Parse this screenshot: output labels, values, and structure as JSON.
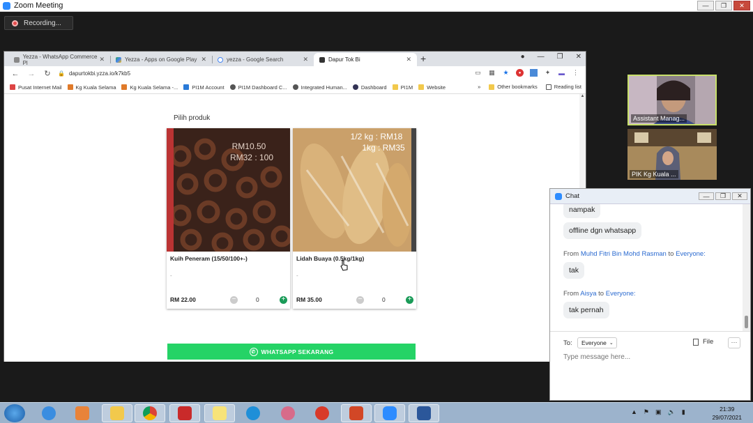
{
  "zoom": {
    "title": "Zoom Meeting",
    "recording": "Recording..."
  },
  "browser": {
    "tabs": [
      {
        "label": "Yezza - WhatsApp Commerce Pl"
      },
      {
        "label": "Yezza - Apps on Google Play"
      },
      {
        "label": "yezza - Google Search"
      },
      {
        "label": "Dapur Tok Bi"
      }
    ],
    "url": "dapurtokbi.yzza.io/k7kb5",
    "bookmarks": [
      "Pusat Internet Mail",
      "Kg Kuala Selama",
      "Kg Kuala Selama -...",
      "PI1M Account",
      "PI1M Dashboard C...",
      "Integrated Human...",
      "Dashboard",
      "PI1M",
      "Website"
    ],
    "bookmarks_more": "»",
    "other_bookmarks": "Other bookmarks",
    "reading_list": "Reading list"
  },
  "shop": {
    "section_title": "Pilih produk",
    "products": [
      {
        "name": "Kuih Peneram (15/50/100+-)",
        "desc": "-",
        "price": "RM 22.00",
        "qty": "0",
        "img_text1": "RM10.50",
        "img_text2": "RM32 : 100"
      },
      {
        "name": "Lidah Buaya (0.5kg/1kg)",
        "desc": "-",
        "price": "RM 35.00",
        "qty": "0",
        "img_text1": "1/2 kg : RM18",
        "img_text2": "1kg : RM35"
      }
    ],
    "whatsapp_button": "WHATSAPP SEKARANG"
  },
  "participants": [
    {
      "name": "Assistant Manag..."
    },
    {
      "name": "PIK Kg Kuala ..."
    }
  ],
  "chat": {
    "title": "Chat",
    "messages": [
      {
        "text": "nampak"
      },
      {
        "text": "offline dgn whatsapp"
      },
      {
        "from_prefix": "From",
        "sender": "Muhd Fitri Bin Mohd Rasman",
        "to_word": "to",
        "recipient": "Everyone:",
        "text": "tak"
      },
      {
        "from_prefix": "From",
        "sender": "Aisya",
        "to_word": "to",
        "recipient": "Everyone:",
        "text": "tak pernah"
      }
    ],
    "to_label": "To:",
    "to_value": "Everyone",
    "file_label": "File",
    "more_label": "···",
    "input_placeholder": "Type message here..."
  },
  "taskbar": {
    "time": "21:39",
    "date": "29/07/2021"
  }
}
